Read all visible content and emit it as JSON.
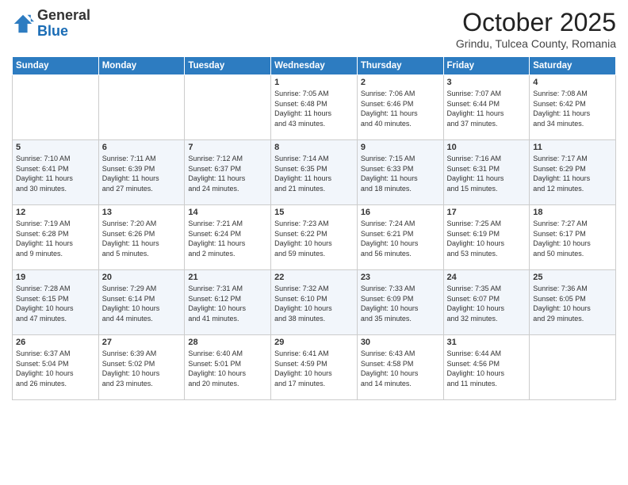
{
  "logo": {
    "general": "General",
    "blue": "Blue"
  },
  "header": {
    "month": "October 2025",
    "location": "Grindu, Tulcea County, Romania"
  },
  "weekdays": [
    "Sunday",
    "Monday",
    "Tuesday",
    "Wednesday",
    "Thursday",
    "Friday",
    "Saturday"
  ],
  "weeks": [
    [
      {
        "day": "",
        "info": ""
      },
      {
        "day": "",
        "info": ""
      },
      {
        "day": "",
        "info": ""
      },
      {
        "day": "1",
        "info": "Sunrise: 7:05 AM\nSunset: 6:48 PM\nDaylight: 11 hours\nand 43 minutes."
      },
      {
        "day": "2",
        "info": "Sunrise: 7:06 AM\nSunset: 6:46 PM\nDaylight: 11 hours\nand 40 minutes."
      },
      {
        "day": "3",
        "info": "Sunrise: 7:07 AM\nSunset: 6:44 PM\nDaylight: 11 hours\nand 37 minutes."
      },
      {
        "day": "4",
        "info": "Sunrise: 7:08 AM\nSunset: 6:42 PM\nDaylight: 11 hours\nand 34 minutes."
      }
    ],
    [
      {
        "day": "5",
        "info": "Sunrise: 7:10 AM\nSunset: 6:41 PM\nDaylight: 11 hours\nand 30 minutes."
      },
      {
        "day": "6",
        "info": "Sunrise: 7:11 AM\nSunset: 6:39 PM\nDaylight: 11 hours\nand 27 minutes."
      },
      {
        "day": "7",
        "info": "Sunrise: 7:12 AM\nSunset: 6:37 PM\nDaylight: 11 hours\nand 24 minutes."
      },
      {
        "day": "8",
        "info": "Sunrise: 7:14 AM\nSunset: 6:35 PM\nDaylight: 11 hours\nand 21 minutes."
      },
      {
        "day": "9",
        "info": "Sunrise: 7:15 AM\nSunset: 6:33 PM\nDaylight: 11 hours\nand 18 minutes."
      },
      {
        "day": "10",
        "info": "Sunrise: 7:16 AM\nSunset: 6:31 PM\nDaylight: 11 hours\nand 15 minutes."
      },
      {
        "day": "11",
        "info": "Sunrise: 7:17 AM\nSunset: 6:29 PM\nDaylight: 11 hours\nand 12 minutes."
      }
    ],
    [
      {
        "day": "12",
        "info": "Sunrise: 7:19 AM\nSunset: 6:28 PM\nDaylight: 11 hours\nand 9 minutes."
      },
      {
        "day": "13",
        "info": "Sunrise: 7:20 AM\nSunset: 6:26 PM\nDaylight: 11 hours\nand 5 minutes."
      },
      {
        "day": "14",
        "info": "Sunrise: 7:21 AM\nSunset: 6:24 PM\nDaylight: 11 hours\nand 2 minutes."
      },
      {
        "day": "15",
        "info": "Sunrise: 7:23 AM\nSunset: 6:22 PM\nDaylight: 10 hours\nand 59 minutes."
      },
      {
        "day": "16",
        "info": "Sunrise: 7:24 AM\nSunset: 6:21 PM\nDaylight: 10 hours\nand 56 minutes."
      },
      {
        "day": "17",
        "info": "Sunrise: 7:25 AM\nSunset: 6:19 PM\nDaylight: 10 hours\nand 53 minutes."
      },
      {
        "day": "18",
        "info": "Sunrise: 7:27 AM\nSunset: 6:17 PM\nDaylight: 10 hours\nand 50 minutes."
      }
    ],
    [
      {
        "day": "19",
        "info": "Sunrise: 7:28 AM\nSunset: 6:15 PM\nDaylight: 10 hours\nand 47 minutes."
      },
      {
        "day": "20",
        "info": "Sunrise: 7:29 AM\nSunset: 6:14 PM\nDaylight: 10 hours\nand 44 minutes."
      },
      {
        "day": "21",
        "info": "Sunrise: 7:31 AM\nSunset: 6:12 PM\nDaylight: 10 hours\nand 41 minutes."
      },
      {
        "day": "22",
        "info": "Sunrise: 7:32 AM\nSunset: 6:10 PM\nDaylight: 10 hours\nand 38 minutes."
      },
      {
        "day": "23",
        "info": "Sunrise: 7:33 AM\nSunset: 6:09 PM\nDaylight: 10 hours\nand 35 minutes."
      },
      {
        "day": "24",
        "info": "Sunrise: 7:35 AM\nSunset: 6:07 PM\nDaylight: 10 hours\nand 32 minutes."
      },
      {
        "day": "25",
        "info": "Sunrise: 7:36 AM\nSunset: 6:05 PM\nDaylight: 10 hours\nand 29 minutes."
      }
    ],
    [
      {
        "day": "26",
        "info": "Sunrise: 6:37 AM\nSunset: 5:04 PM\nDaylight: 10 hours\nand 26 minutes."
      },
      {
        "day": "27",
        "info": "Sunrise: 6:39 AM\nSunset: 5:02 PM\nDaylight: 10 hours\nand 23 minutes."
      },
      {
        "day": "28",
        "info": "Sunrise: 6:40 AM\nSunset: 5:01 PM\nDaylight: 10 hours\nand 20 minutes."
      },
      {
        "day": "29",
        "info": "Sunrise: 6:41 AM\nSunset: 4:59 PM\nDaylight: 10 hours\nand 17 minutes."
      },
      {
        "day": "30",
        "info": "Sunrise: 6:43 AM\nSunset: 4:58 PM\nDaylight: 10 hours\nand 14 minutes."
      },
      {
        "day": "31",
        "info": "Sunrise: 6:44 AM\nSunset: 4:56 PM\nDaylight: 10 hours\nand 11 minutes."
      },
      {
        "day": "",
        "info": ""
      }
    ]
  ]
}
